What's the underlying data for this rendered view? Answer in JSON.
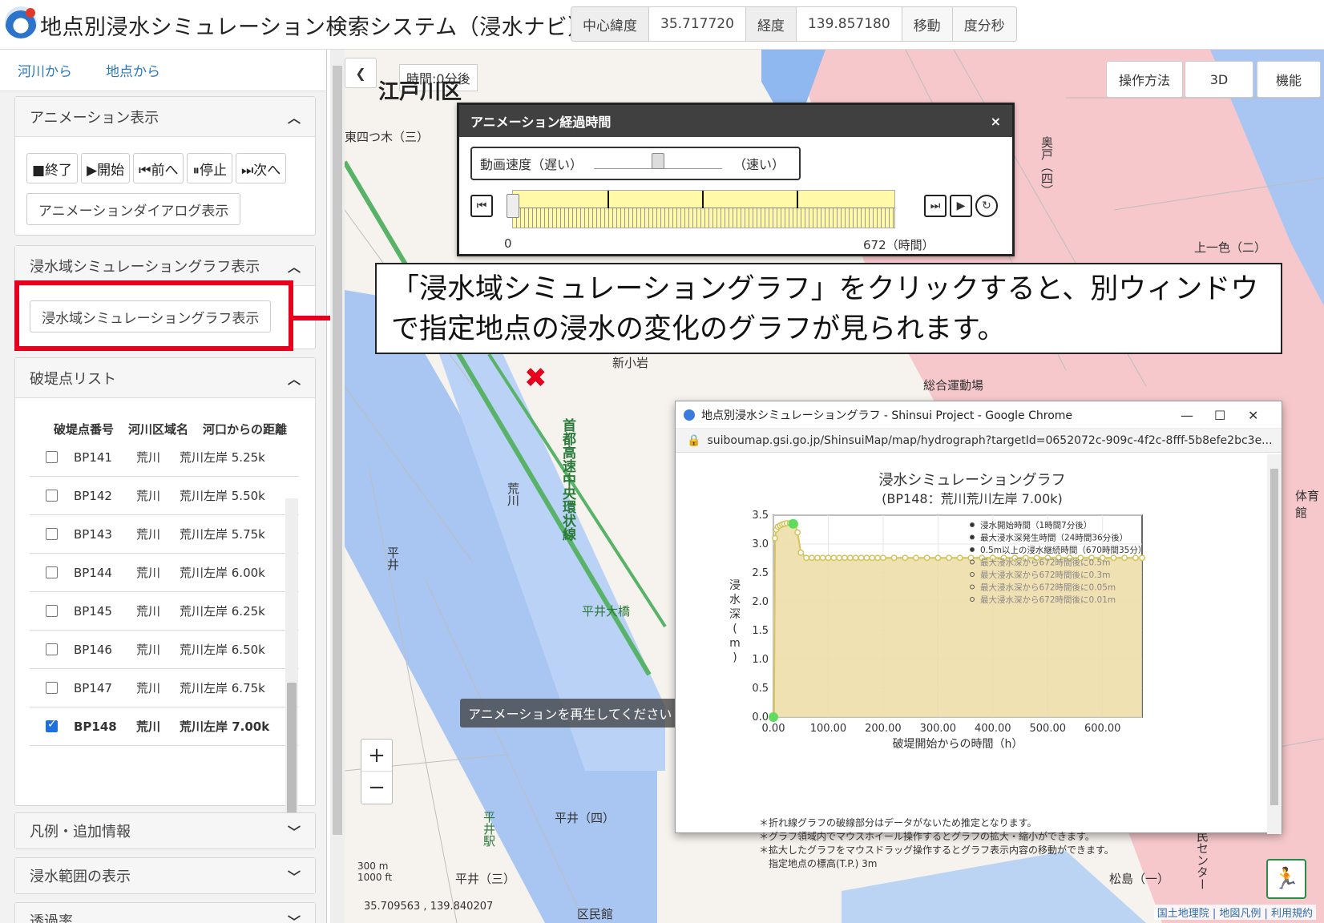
{
  "app": {
    "title": "地点別浸水シミュレーション検索システム（浸水ナビ）",
    "coords": {
      "lat_label": "中心緯度",
      "lat": "35.717720",
      "lon_label": "経度",
      "lon": "139.857180",
      "move": "移動",
      "dms": "度分秒"
    }
  },
  "sidebar": {
    "tabs": [
      "河川から",
      "地点から"
    ],
    "anim_panel": {
      "title": "アニメーション表示",
      "buttons": [
        "■終了",
        "▶開始",
        "⏮前へ",
        "⏸停止",
        "⏭次へ"
      ],
      "dialog_btn": "アニメーションダイアログ表示"
    },
    "graph_panel": {
      "title": "浸水域シミュレーショングラフ表示",
      "button": "浸水域シミュレーショングラフ表示"
    },
    "bp_panel": {
      "title": "破堤点リスト",
      "headers": [
        "破堤点番号",
        "河川区域名",
        "河口からの距離"
      ],
      "rows": [
        {
          "id": "BP141",
          "river": "荒川",
          "dist": "荒川左岸 5.25k",
          "checked": false
        },
        {
          "id": "BP142",
          "river": "荒川",
          "dist": "荒川左岸 5.50k",
          "checked": false
        },
        {
          "id": "BP143",
          "river": "荒川",
          "dist": "荒川左岸 5.75k",
          "checked": false
        },
        {
          "id": "BP144",
          "river": "荒川",
          "dist": "荒川左岸 6.00k",
          "checked": false
        },
        {
          "id": "BP145",
          "river": "荒川",
          "dist": "荒川左岸 6.25k",
          "checked": false
        },
        {
          "id": "BP146",
          "river": "荒川",
          "dist": "荒川左岸 6.50k",
          "checked": false
        },
        {
          "id": "BP147",
          "river": "荒川",
          "dist": "荒川左岸 6.75k",
          "checked": false
        },
        {
          "id": "BP148",
          "river": "荒川",
          "dist": "荒川左岸 7.00k",
          "checked": true
        }
      ]
    },
    "collapsed": [
      "凡例・追加情報",
      "浸水範囲の表示",
      "透過率"
    ]
  },
  "map": {
    "time_label": "時間:0分後",
    "buttons": [
      "操作方法",
      "3D",
      "機能"
    ],
    "labels": [
      "江戸川区",
      "東四つ木（三）",
      "新小岩",
      "総合運動場",
      "荒川",
      "首都高速中央環状線",
      "平井大橋",
      "平井",
      "平井（四）",
      "平井（三）",
      "平井駅",
      "松島（一）",
      "奥戸（四）",
      "上一色（二）",
      "区民館",
      "体育館",
      "民センター"
    ],
    "tooltip": "アニメーションを再生してください",
    "scale_m": "300 m",
    "scale_ft": "1000 ft",
    "center_coords": "35.709563 , 139.840207",
    "attribution": "国土地理院 | 地図凡例 | 利用規約",
    "back_icon": "chevron-left-icon"
  },
  "anim_dialog": {
    "title": "アニメーション経過時間",
    "speed_label": "動画速度（遅い）",
    "speed_fast": "（速い）",
    "start": "0",
    "end": "672（時間）",
    "close": "×"
  },
  "callout": {
    "text": "「浸水域シミュレーショングラフ」をクリックすると、別ウィンドウで指定地点の浸水の変化のグラフが見られます。"
  },
  "graph_window": {
    "title": "地点別浸水シミュレーショングラフ - Shinsui Project - Google Chrome",
    "url": "suiboumap.gsi.go.jp/ShinsuiMap/map/hydrograph?targetId=0652072c-909c-4f2c-8fff-5b8efe2bc3e...",
    "chart_title": "浸水シミュレーショングラフ",
    "chart_subtitle": "(BP148：荒川荒川左岸 7.00k)",
    "notes": [
      "＊折れ線グラフの破線部分はデータがないため推定となります。",
      "＊グラフ領域内でマウスホイール操作するとグラフの拡大・縮小ができます。",
      "＊拡大したグラフをマウスドラッグ操作するとグラフ表示内容の移動ができます。",
      "　指定地点の標高(T.P.) 3m"
    ]
  },
  "chart_data": {
    "type": "area",
    "title": "浸水シミュレーショングラフ",
    "subtitle": "(BP148：荒川荒川左岸 7.00k)",
    "xlabel": "破堤開始からの時間（h）",
    "ylabel": "浸水深(m)",
    "xlim": [
      0,
      672
    ],
    "ylim": [
      0,
      3.5
    ],
    "xticks": [
      "0.00",
      "100.00",
      "200.00",
      "300.00",
      "400.00",
      "500.00",
      "600.00"
    ],
    "yticks": [
      "0.0",
      "0.5",
      "1.0",
      "1.5",
      "2.0",
      "2.5",
      "3.0",
      "3.5"
    ],
    "x": [
      0,
      1.1,
      3,
      5,
      8,
      12,
      16,
      20,
      24.6,
      30,
      36,
      40,
      44,
      50,
      60,
      70,
      80,
      90,
      100,
      110,
      120,
      130,
      140,
      150,
      160,
      170,
      180,
      190,
      200,
      220,
      240,
      260,
      280,
      300,
      320,
      340,
      360,
      380,
      400,
      420,
      440,
      460,
      480,
      500,
      520,
      540,
      560,
      580,
      600,
      620,
      640,
      660,
      672
    ],
    "y": [
      0,
      0.02,
      3.1,
      3.25,
      3.3,
      3.32,
      3.34,
      3.35,
      3.36,
      3.36,
      3.35,
      3.34,
      3.2,
      2.85,
      2.76,
      2.76,
      2.76,
      2.76,
      2.76,
      2.76,
      2.76,
      2.76,
      2.76,
      2.76,
      2.76,
      2.76,
      2.76,
      2.76,
      2.76,
      2.76,
      2.76,
      2.76,
      2.76,
      2.76,
      2.76,
      2.76,
      2.76,
      2.76,
      2.76,
      2.76,
      2.76,
      2.76,
      2.76,
      2.76,
      2.76,
      2.76,
      2.76,
      2.76,
      2.76,
      2.76,
      2.76,
      2.76,
      2.76
    ],
    "legend": [
      "浸水開始時間（1時間7分後）",
      "最大浸水深発生時間（24時間36分後）",
      "0.5m以上の浸水継続時間（670時間35分）",
      "最大浸水深から672時間後に0.5m",
      "最大浸水深から672時間後に0.3m",
      "最大浸水深から672時間後に0.05m",
      "最大浸水深から672時間後に0.01m"
    ],
    "legend_position": "top-right",
    "colors": {
      "line": "#d6c35a",
      "fill": "#ecdca5",
      "marker_start": "#5fdc5f"
    },
    "grid": true
  }
}
